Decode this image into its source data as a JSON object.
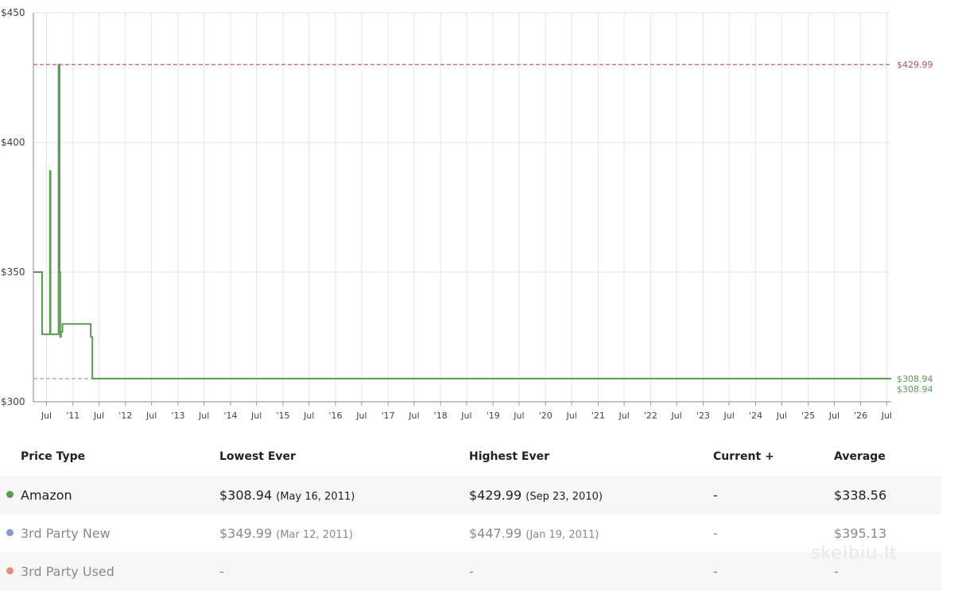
{
  "colors": {
    "amazon": "#5a9a52",
    "third_new": "#8898cc",
    "third_used": "#e08f7e",
    "highest_line": "#c0504d",
    "lowest_line": "#5a9a52",
    "grid": "#e6e6e6"
  },
  "chart_data": {
    "type": "line",
    "y_tick_labels": [
      "$450",
      "$400",
      "$350",
      "$300"
    ],
    "y_ticks": [
      450,
      400,
      350,
      300
    ],
    "ylim": [
      300,
      450
    ],
    "xlim": [
      "2010-04-01",
      "2026-08-01"
    ],
    "x_tick_labels": [
      "Jul",
      "'11",
      "Jul",
      "'12",
      "Jul",
      "'13",
      "Jul",
      "'14",
      "Jul",
      "'15",
      "Jul",
      "'16",
      "Jul",
      "'17",
      "Jul",
      "'18",
      "Jul",
      "'19",
      "Jul",
      "'20",
      "Jul",
      "'21",
      "Jul",
      "'22",
      "Jul",
      "'23",
      "Jul",
      "'24",
      "Jul",
      "'25",
      "Jul",
      "'26",
      "Jul"
    ],
    "x_tick_dates": [
      "2010-07-01",
      "2011-01-01",
      "2011-07-01",
      "2012-01-01",
      "2012-07-01",
      "2013-01-01",
      "2013-07-01",
      "2014-01-01",
      "2014-07-01",
      "2015-01-01",
      "2015-07-01",
      "2016-01-01",
      "2016-07-01",
      "2017-01-01",
      "2017-07-01",
      "2018-01-01",
      "2018-07-01",
      "2019-01-01",
      "2019-07-01",
      "2020-01-01",
      "2020-07-01",
      "2021-01-01",
      "2021-07-01",
      "2022-01-01",
      "2022-07-01",
      "2023-01-01",
      "2023-07-01",
      "2024-01-01",
      "2024-07-01",
      "2025-01-01",
      "2025-07-01",
      "2026-01-01",
      "2026-07-01"
    ],
    "grid": true,
    "series": [
      {
        "name": "Amazon",
        "step": true,
        "x": [
          "2010-04-01",
          "2010-06-01",
          "2010-07-25",
          "2010-07-29",
          "2010-09-01",
          "2010-09-23",
          "2010-09-30",
          "2010-10-05",
          "2010-10-10",
          "2010-10-20",
          "2010-11-01",
          "2011-01-01",
          "2011-05-05",
          "2011-05-16",
          "2026-08-01"
        ],
        "values": [
          350,
          326,
          389,
          326,
          326,
          429.99,
          350,
          325,
          327,
          330,
          330,
          330,
          325,
          308.94,
          308.94
        ]
      }
    ],
    "reference_lines": [
      {
        "value": 429.99,
        "label": "$429.99",
        "kind": "highest"
      },
      {
        "value": 308.94,
        "label": "$308.94",
        "kind": "lowest"
      },
      {
        "value": 308.94,
        "label": "$308.94",
        "kind": "current"
      }
    ]
  },
  "table": {
    "headers": [
      "Price Type",
      "Lowest Ever",
      "Highest Ever",
      "Current +",
      "Average"
    ],
    "rows": [
      {
        "type": "Amazon",
        "lowest": "$308.94",
        "lowest_date": "(May 16, 2011)",
        "highest": "$429.99",
        "highest_date": "(Sep 23, 2010)",
        "current": "-",
        "average": "$338.56"
      },
      {
        "type": "3rd Party New",
        "lowest": "$349.99",
        "lowest_date": "(Mar 12, 2011)",
        "highest": "$447.99",
        "highest_date": "(Jan 19, 2011)",
        "current": "-",
        "average": "$395.13"
      },
      {
        "type": "3rd Party Used",
        "lowest": "-",
        "lowest_date": "",
        "highest": "-",
        "highest_date": "",
        "current": "-",
        "average": "-"
      }
    ]
  },
  "watermark": "skelbiu.lt"
}
